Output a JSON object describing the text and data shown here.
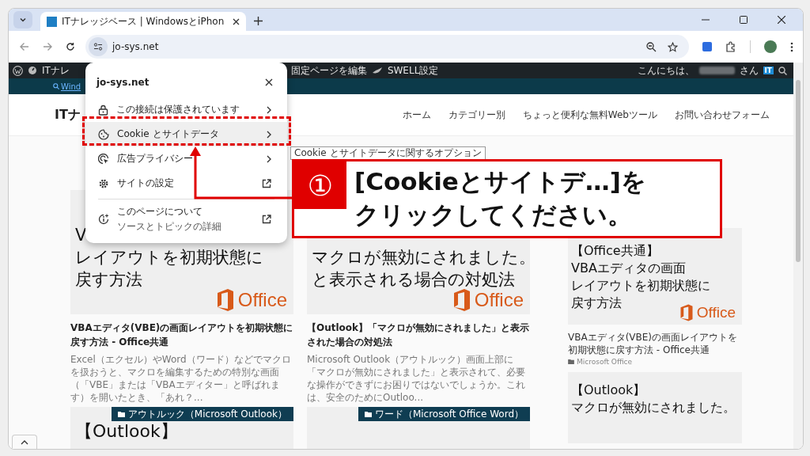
{
  "browser": {
    "tabs": [
      {
        "title": "ITナレッジベース | WindowsとiPhon",
        "selected": true
      }
    ],
    "address": "jo-sys.net"
  },
  "admin_bar": {
    "site_name": "ITナレ",
    "items": [
      "固定ページを編集",
      "SWELL設定"
    ],
    "greeting": "こんにちは、",
    "honorific": "さん",
    "avatar": "IT"
  },
  "site_header": {
    "breadcrumb_link": "Wind",
    "logo": "ITナ",
    "nav": [
      "ホーム",
      "カテゴリー別",
      "ちょっと便利な無料Webツール",
      "お問い合わせフォーム"
    ]
  },
  "posts": [
    {
      "thumb_lines": [
        "V",
        "レイアウトを初期状態に",
        "戻す方法"
      ],
      "logo_text": "Office",
      "title": "VBAエディタ(VBE)の画面レイアウトを初期状態に戻す方法 - Office共通",
      "excerpt": "Excel（エクセル）やWord（ワード）などでマクロを扱おうと、マクロを編集するための特別な画面（「VBE」または「VBAエディター」と呼ばれます）を開いたとき、「あれ？..."
    },
    {
      "thumb_lines": [
        "マクロが無効にされました。",
        "と表示される場合の対処法"
      ],
      "logo_text": "Office",
      "title": "【Outlook】「マクロが無効にされました」と表示された場合の対処法",
      "excerpt": "Microsoft Outlook（アウトルック）画面上部に「マクロが無効にされました」と表示されて、必要な操作ができずにお困りではないでしょうか。これは、安全のためにOutloo..."
    },
    {
      "category": "アウトルック（Microsoft Outlook）",
      "thumb_lines": [
        "【Outlook】"
      ]
    },
    {
      "category": "ワード（Microsoft Office Word）"
    }
  ],
  "sidebar": {
    "posts": [
      {
        "thumb_lines": [
          "【Office共通】",
          "VBAエディタの画面",
          "レイアウトを初期状態に",
          "戻す方法"
        ],
        "logo_text": "Office",
        "title": "VBAエディタ(VBE)の画面レイアウトを初期状態に戻す方法 - Office共通",
        "category": "Microsoft Office"
      },
      {
        "thumb_lines": [
          "【Outlook】",
          "マクロが無効にされました。"
        ]
      }
    ]
  },
  "site_info_popup": {
    "domain": "jo-sys.net",
    "items": [
      {
        "kind": "lock",
        "label": "この接続は保護されています",
        "external": false,
        "highlighted": false
      },
      {
        "kind": "cookie",
        "label": "Cookie とサイトデータ",
        "external": false,
        "highlighted": true
      },
      {
        "kind": "ads",
        "label": "広告プライバシー",
        "external": false,
        "highlighted": false
      },
      {
        "kind": "settings",
        "label": "サイトの設定",
        "external": true,
        "highlighted": false
      },
      {
        "kind": "about",
        "label": "このページについて",
        "sublabel": "ソースとトピックの詳細",
        "external": true,
        "highlighted": false
      }
    ]
  },
  "tooltip": "Cookie とサイトデータに関するオプション",
  "annotation": {
    "step": "①",
    "lines": [
      "[Cookieとサイトデ…]を",
      "クリックしてください。"
    ]
  }
}
